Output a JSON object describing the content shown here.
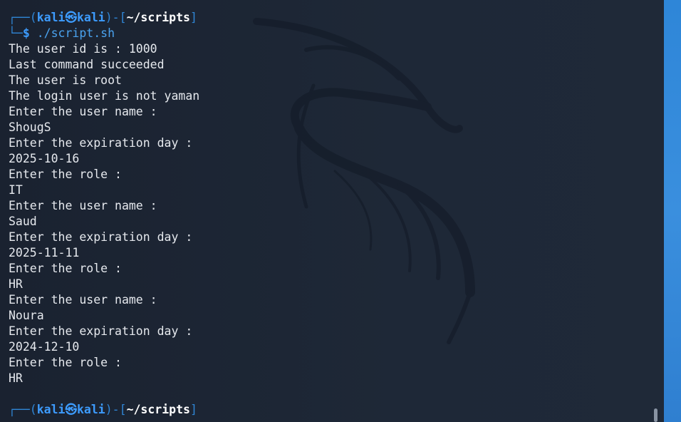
{
  "prompt": {
    "user": "kali",
    "host": "kali",
    "path": "~/scripts",
    "command": "./script.sh"
  },
  "output": [
    "The user id is : 1000",
    "Last command succeeded",
    "The user is root",
    "The login user is not yaman",
    "Enter the user name :",
    "ShougS",
    "Enter the expiration day :",
    "2025-10-16",
    "Enter the role :",
    "IT",
    "Enter the user name :",
    "Saud",
    "Enter the expiration day :",
    "2025-11-11",
    "Enter the role :",
    "HR",
    "Enter the user name :",
    "Noura",
    "Enter the expiration day :",
    "2024-12-10",
    "Enter the role :",
    "HR"
  ],
  "colors": {
    "background": "#1d2634",
    "prompt_blue": "#2f86d6",
    "desktop_blue": "#2e86d8"
  }
}
